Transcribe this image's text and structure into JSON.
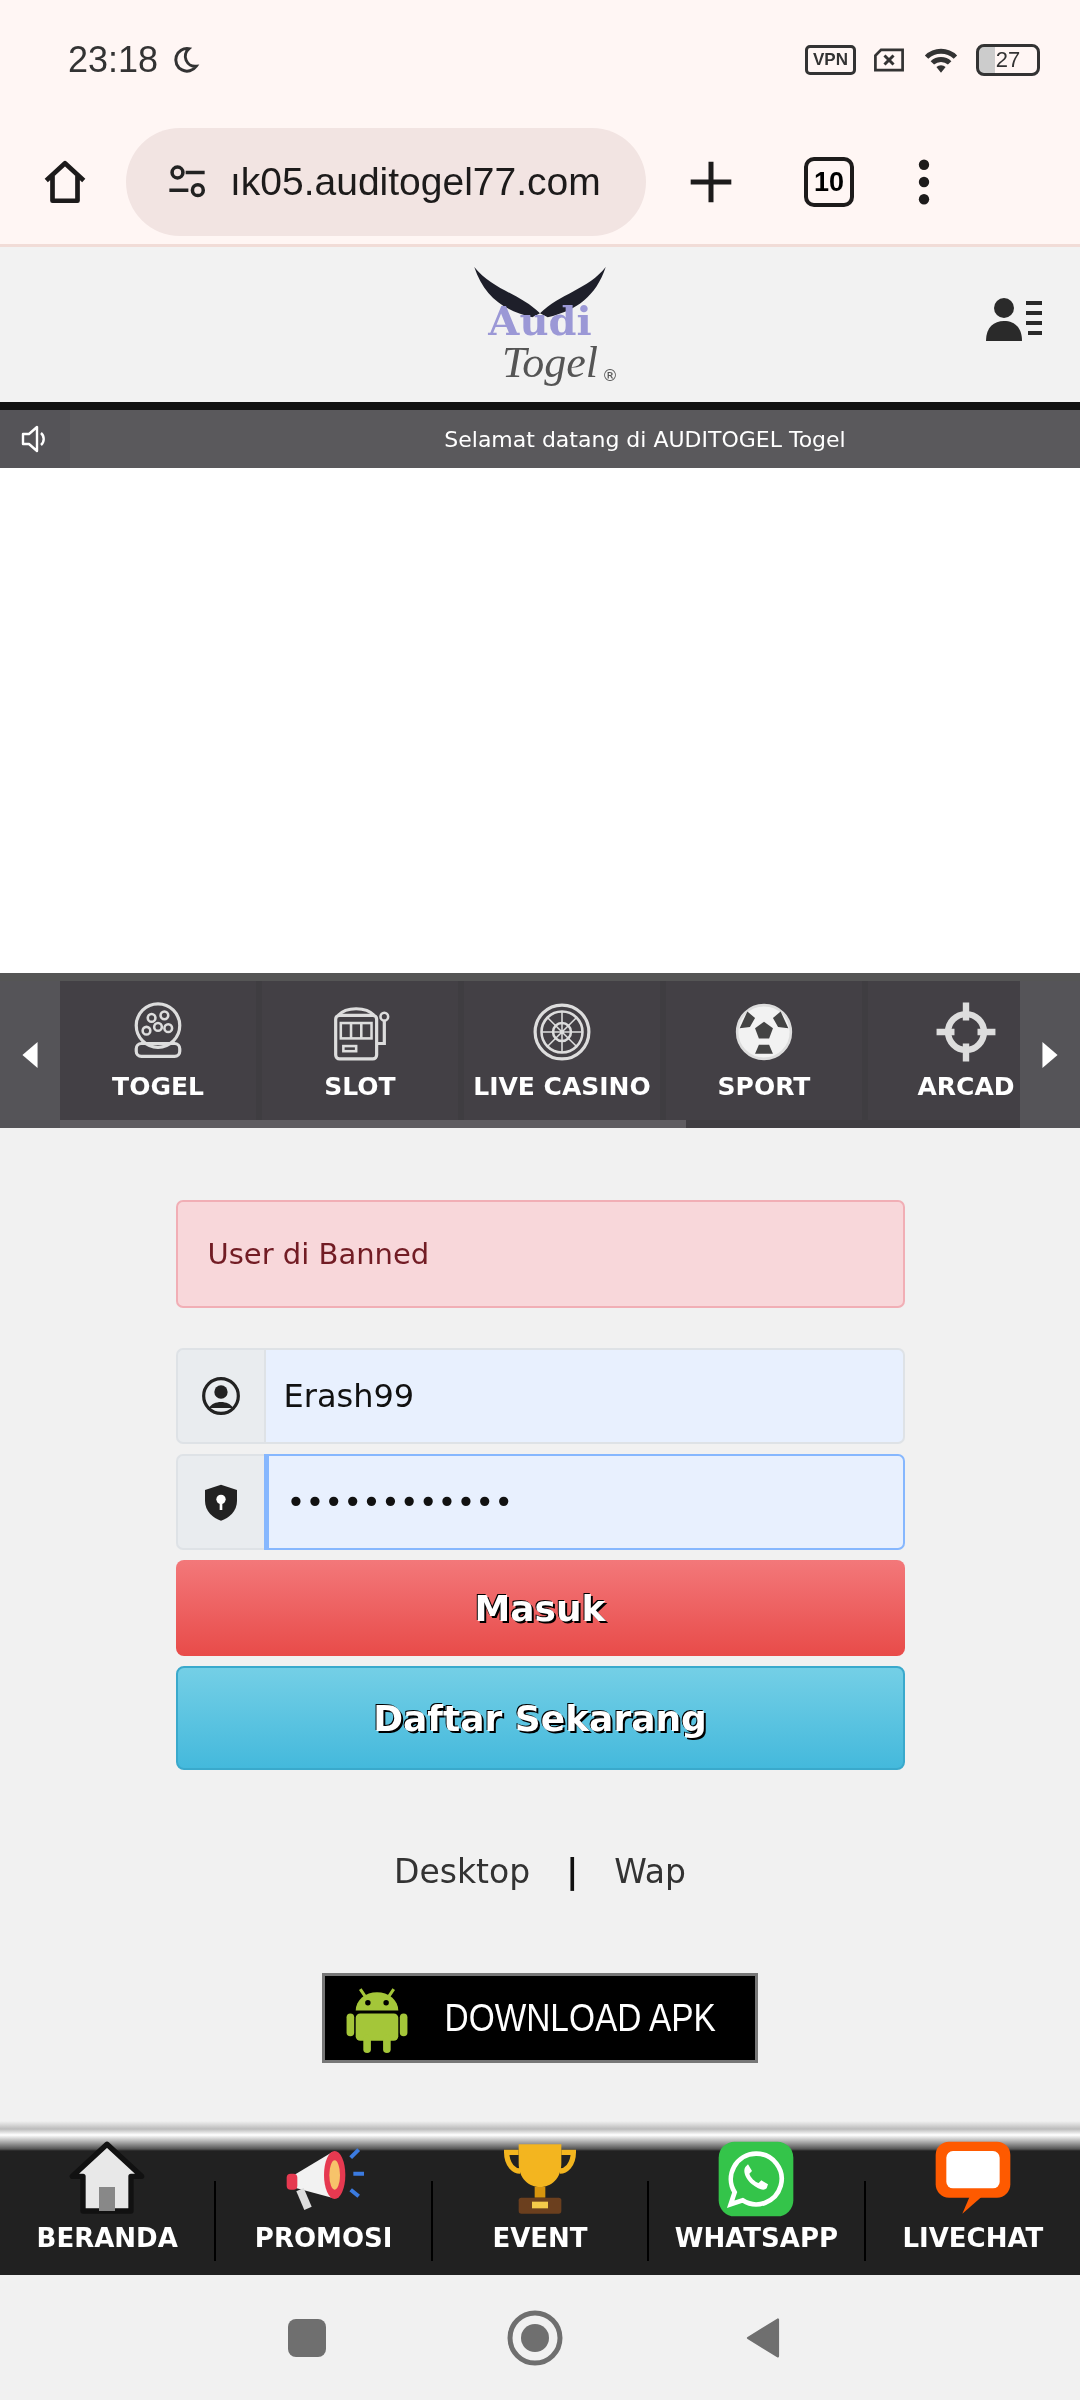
{
  "status_bar": {
    "time": "23:18",
    "vpn": "VPN",
    "battery": "27"
  },
  "browser": {
    "url": "ık05.auditogel77.com",
    "tab_count": "10"
  },
  "header": {
    "logo_word": "Audi",
    "logo_script": "Togel",
    "logo_mark": "®"
  },
  "marquee": {
    "text": "Selamat datang di AUDITOGEL Togel"
  },
  "game_menu": [
    {
      "label": "TOGEL"
    },
    {
      "label": "SLOT"
    },
    {
      "label": "LIVE CASINO"
    },
    {
      "label": "SPORT"
    },
    {
      "label": "ARCAD"
    }
  ],
  "alert": {
    "text": "User di Banned"
  },
  "login": {
    "username": {
      "value": "Erash99",
      "focused": false
    },
    "password": {
      "value": "••••••••••••",
      "focused": true
    }
  },
  "buttons": [
    {
      "kind": "login",
      "label": "Masuk"
    },
    {
      "kind": "register",
      "label": "Daftar Sekarang"
    }
  ],
  "version_links": [
    {
      "label": "Desktop"
    },
    {
      "label": "|",
      "kind": "separator"
    },
    {
      "label": "Wap"
    }
  ],
  "download": {
    "label": "DOWNLOAD APK"
  },
  "bottom_nav": [
    {
      "label": "BERANDA"
    },
    {
      "label": "PROMOSI"
    },
    {
      "label": "EVENT"
    },
    {
      "label": "WHATSAPP"
    },
    {
      "label": "LIVECHAT"
    }
  ]
}
